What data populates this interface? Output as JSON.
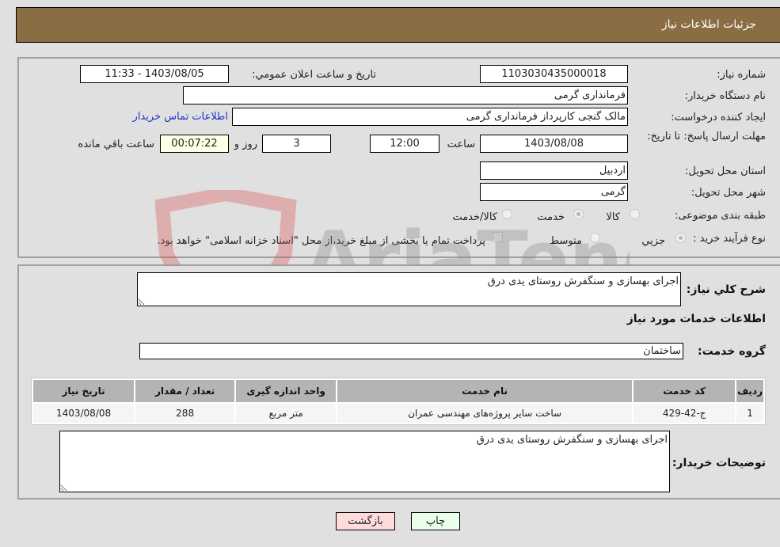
{
  "header": {
    "title": "جزئیات اطلاعات نیاز"
  },
  "form": {
    "need_number": {
      "label": "شماره نیاز:",
      "value": "1103030435000018"
    },
    "announce_datetime": {
      "label": "تاریخ و ساعت اعلان عمومي:",
      "value": "1403/08/05 - 11:33"
    },
    "buyer_org": {
      "label": "نام دستگاه خریدار:",
      "value": "فرمانداری گرمی"
    },
    "requester": {
      "label": "ایجاد کننده درخواست:",
      "value": "مالک گنجی کارپرداز فرمانداری گرمی"
    },
    "buyer_contact_link": "اطلاعات تماس خریدار",
    "deadline": {
      "label": "مهلت ارسال پاسخ: تا تاریخ:",
      "date": "1403/08/08",
      "time_label": "ساعت",
      "time": "12:00",
      "days": "3",
      "days_label": "روز و",
      "remaining": "00:07:22",
      "remaining_label": "ساعت باقي مانده"
    },
    "province": {
      "label": "استان محل تحویل:",
      "value": "اردبیل"
    },
    "city": {
      "label": "شهر محل تحویل:",
      "value": "گرمی"
    },
    "category": {
      "label": "طبقه بندی موضوعی:",
      "options": [
        "کالا",
        "خدمت",
        "کالا/خدمت"
      ],
      "selected": "خدمت"
    },
    "process_type": {
      "label": "نوع فرآیند خرید :",
      "options": [
        "جزيي",
        "متوسط"
      ],
      "selected": "جزيي",
      "treasury_note": "پرداخت تمام یا بخشی از مبلغ خرید،از محل \"اسناد خزانه اسلامی\" خواهد بود."
    }
  },
  "details": {
    "description_label": "شرح كلي نياز:",
    "description": "اجرای بهسازی و سنگفرش روستای یدی درق",
    "services_heading": "اطلاعات خدمات مورد نياز",
    "service_group_label": "گروه خدمت:",
    "service_group": "ساختمان",
    "table": {
      "headers": [
        "ردیف",
        "کد خدمت",
        "نام خدمت",
        "واحد اندازه گیری",
        "تعداد / مقدار",
        "تاریخ نیاز"
      ],
      "rows": [
        [
          "1",
          "ج-42-429",
          "ساخت سایر پروژه‌های مهندسی عمران",
          "متر مربع",
          "288",
          "1403/08/08"
        ]
      ]
    },
    "buyer_notes_label": "توضیحات خریدار:",
    "buyer_notes": "اجرای بهسازی و سنگفرش روستای یدی درق"
  },
  "buttons": {
    "print": "چاپ",
    "back": "بازگشت"
  },
  "watermark": {
    "text": "AriaTender.neT"
  },
  "colors": {
    "header_bg": "#8b6d43",
    "back_btn": "#ffdcdc",
    "print_btn": "#eaffea",
    "link": "#1a33cc"
  }
}
